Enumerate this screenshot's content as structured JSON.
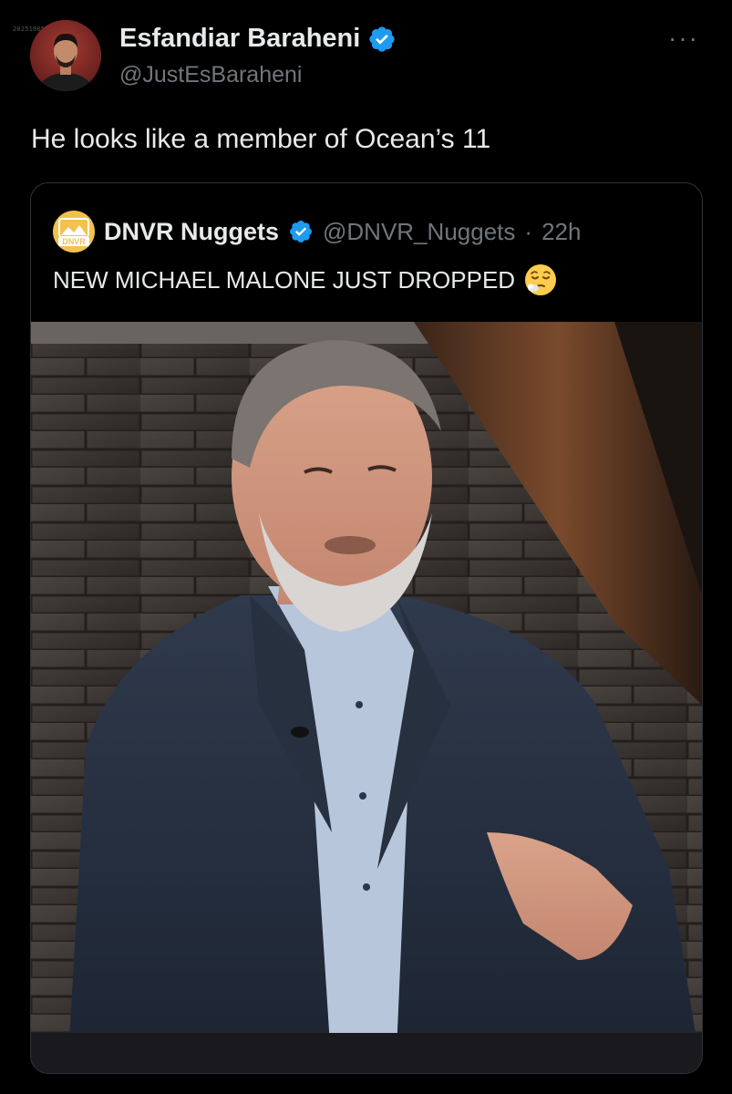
{
  "watermark": "20251005025933_ERS",
  "author": {
    "display_name": "Esfandiar Baraheni",
    "handle": "@JustEsBaraheni"
  },
  "more_label": "···",
  "tweet_text": "He looks like a member of Ocean’s 11",
  "quote": {
    "display_name": "DNVR Nuggets",
    "handle": "@DNVR_Nuggets",
    "separator": "·",
    "time": "22h",
    "text": "NEW MICHAEL MALONE JUST DROPPED",
    "logo_text": "DNVR"
  },
  "colors": {
    "verified": "#1d9bf0",
    "logo": "#f2c14e",
    "secondary_text": "#71767b"
  },
  "icons": {
    "verified": "verified-badge-icon",
    "more": "more-options-icon",
    "emoji": "relieved-face-emoji"
  }
}
